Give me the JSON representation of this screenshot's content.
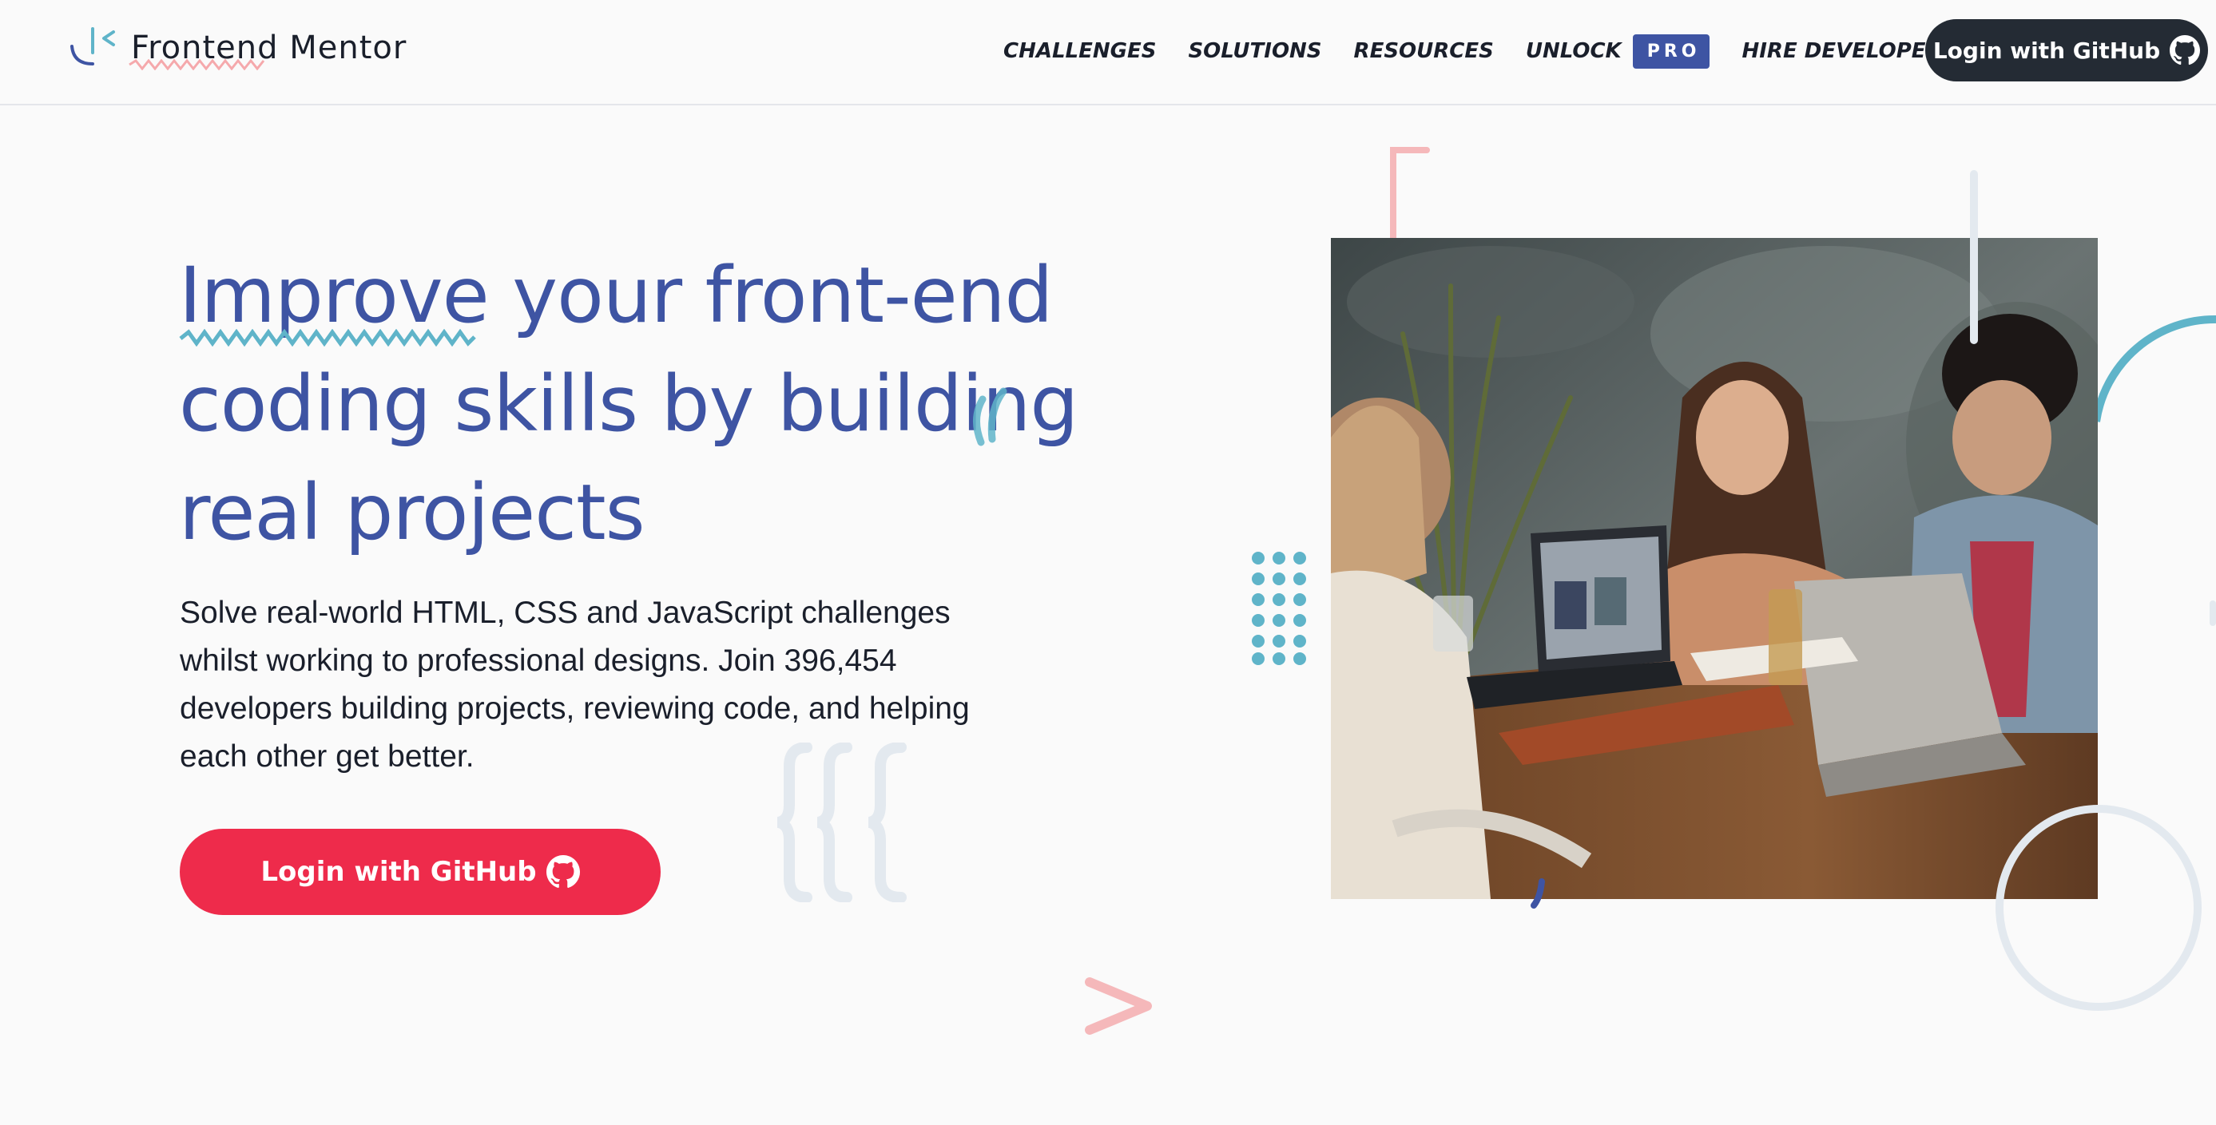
{
  "header": {
    "logo_text": "Frontend Mentor",
    "nav": {
      "challenges": "CHALLENGES",
      "solutions": "SOLUTIONS",
      "resources": "RESOURCES",
      "unlock": "UNLOCK",
      "pro_badge": "PRO",
      "hire": "HIRE DEVELOPERS"
    },
    "login_label": "Login with GitHub"
  },
  "hero": {
    "headline_first": "Improve",
    "headline_rest": "your front-end coding skills by building real projects",
    "subtext": "Solve real-world HTML, CSS and JavaScript challenges whilst working to professional designs. Join 396,454 developers building projects, reviewing code, and helping each other get better.",
    "login_label": "Login with GitHub"
  },
  "icons": {
    "github": "github-icon",
    "logo": "logo-icon"
  },
  "colors": {
    "primary_blue": "#3e54a3",
    "accent_red": "#ee2b4b",
    "dark": "#242b34",
    "teal": "#5fb4c9",
    "pink": "#f5a9ac"
  }
}
